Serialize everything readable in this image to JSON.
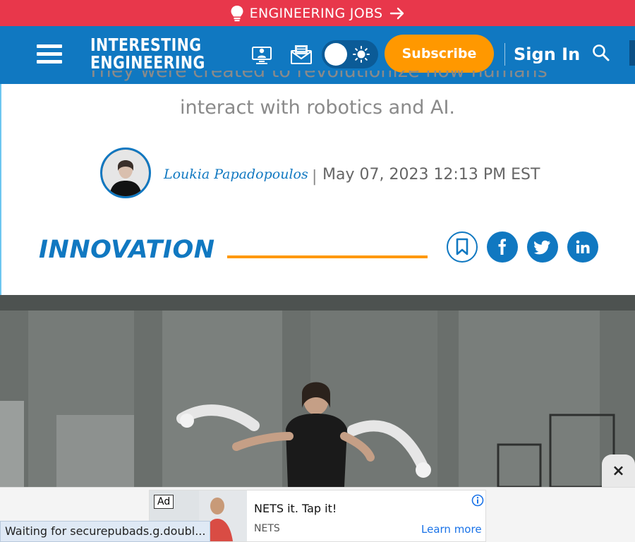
{
  "jobs_banner": {
    "label": "ENGINEERING JOBS"
  },
  "header": {
    "logo_line1": "INTERESTING",
    "logo_line2": "ENGINEERING",
    "subscribe_label": "Subscribe",
    "signin_label": "Sign In",
    "icons": [
      "menu-icon",
      "webinar-icon",
      "newsletter-icon",
      "theme-toggle",
      "search-icon"
    ]
  },
  "article": {
    "subtitle_line1": "They were created to revolutionize how humans",
    "subtitle_line2": "interact with robotics and AI.",
    "author": "Loukia Papadopoulos",
    "separator": "|",
    "date": "May 07, 2023 12:13 PM EST",
    "category": "INNOVATION",
    "share": [
      "bookmark-icon",
      "facebook-icon",
      "twitter-icon",
      "linkedin-icon"
    ]
  },
  "ad": {
    "badge": "Ad",
    "headline": "NETS it. Tap it!",
    "brand": "NETS",
    "cta": "Learn more",
    "close_label": "×"
  },
  "status_bar": {
    "text": "Waiting for securepubads.g.doubl..."
  },
  "colors": {
    "brand_blue": "#1078c1",
    "accent_orange": "#ff9800",
    "jobs_red": "#e8374b"
  }
}
